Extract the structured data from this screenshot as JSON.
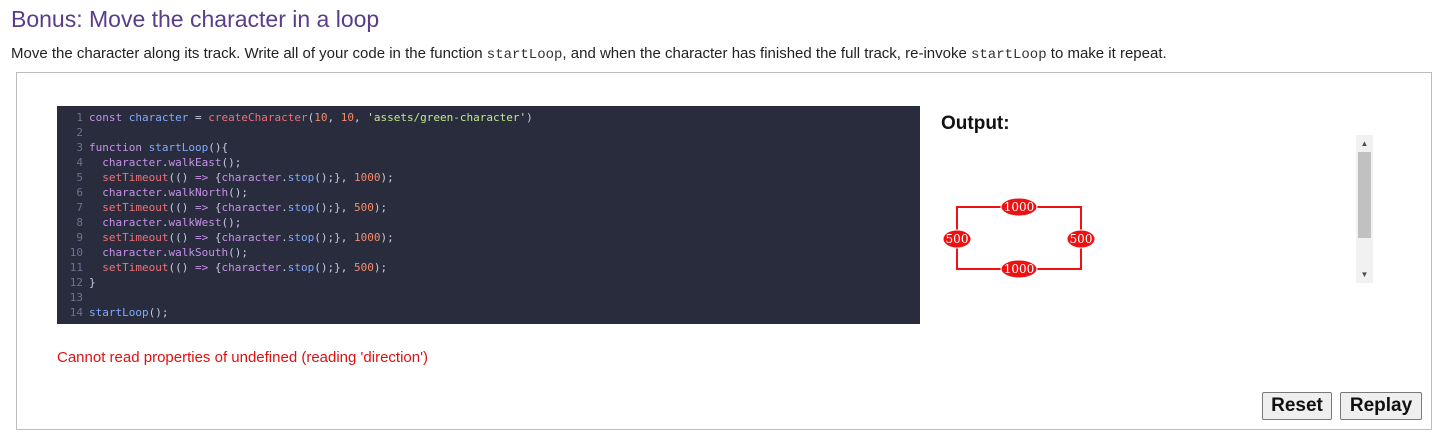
{
  "header": {
    "title": "Bonus: Move the character in a loop",
    "description": {
      "part1": "Move the character along its track. Write all of your code in the function ",
      "code1": "startLoop",
      "part2": ", and when the character has finished the full track, re-invoke ",
      "code2": "startLoop",
      "part3": " to make it repeat."
    }
  },
  "editor": {
    "lines": [
      {
        "n": "1",
        "tokens": [
          [
            "kw",
            "const "
          ],
          [
            "var",
            "character"
          ],
          [
            "punc",
            " = "
          ],
          [
            "fn",
            "createCharacter"
          ],
          [
            "punc",
            "("
          ],
          [
            "num",
            "10"
          ],
          [
            "punc",
            ", "
          ],
          [
            "num",
            "10"
          ],
          [
            "punc",
            ", "
          ],
          [
            "str",
            "'assets/green-character'"
          ],
          [
            "punc",
            ")"
          ]
        ]
      },
      {
        "n": "2",
        "tokens": []
      },
      {
        "n": "3",
        "tokens": [
          [
            "kw",
            "function "
          ],
          [
            "var",
            "startLoop"
          ],
          [
            "punc",
            "(){"
          ]
        ]
      },
      {
        "n": "4",
        "tokens": [
          [
            "punc",
            "  "
          ],
          [
            "meth",
            "character"
          ],
          [
            "punc",
            "."
          ],
          [
            "meth",
            "walkEast"
          ],
          [
            "punc",
            "();"
          ]
        ]
      },
      {
        "n": "5",
        "tokens": [
          [
            "punc",
            "  "
          ],
          [
            "fn",
            "setTimeout"
          ],
          [
            "punc",
            "(() "
          ],
          [
            "kw",
            "=>"
          ],
          [
            "punc",
            " {"
          ],
          [
            "meth",
            "character"
          ],
          [
            "punc",
            "."
          ],
          [
            "var",
            "stop"
          ],
          [
            "punc",
            "();}, "
          ],
          [
            "num",
            "1000"
          ],
          [
            "punc",
            ");"
          ]
        ]
      },
      {
        "n": "6",
        "tokens": [
          [
            "punc",
            "  "
          ],
          [
            "meth",
            "character"
          ],
          [
            "punc",
            "."
          ],
          [
            "meth",
            "walkNorth"
          ],
          [
            "punc",
            "();"
          ]
        ]
      },
      {
        "n": "7",
        "tokens": [
          [
            "punc",
            "  "
          ],
          [
            "fn",
            "setTimeout"
          ],
          [
            "punc",
            "(() "
          ],
          [
            "kw",
            "=>"
          ],
          [
            "punc",
            " {"
          ],
          [
            "meth",
            "character"
          ],
          [
            "punc",
            "."
          ],
          [
            "var",
            "stop"
          ],
          [
            "punc",
            "();}, "
          ],
          [
            "num",
            "500"
          ],
          [
            "punc",
            ");"
          ]
        ]
      },
      {
        "n": "8",
        "tokens": [
          [
            "punc",
            "  "
          ],
          [
            "meth",
            "character"
          ],
          [
            "punc",
            "."
          ],
          [
            "meth",
            "walkWest"
          ],
          [
            "punc",
            "();"
          ]
        ]
      },
      {
        "n": "9",
        "tokens": [
          [
            "punc",
            "  "
          ],
          [
            "fn",
            "setTimeout"
          ],
          [
            "punc",
            "(() "
          ],
          [
            "kw",
            "=>"
          ],
          [
            "punc",
            " {"
          ],
          [
            "meth",
            "character"
          ],
          [
            "punc",
            "."
          ],
          [
            "var",
            "stop"
          ],
          [
            "punc",
            "();}, "
          ],
          [
            "num",
            "1000"
          ],
          [
            "punc",
            ");"
          ]
        ]
      },
      {
        "n": "10",
        "tokens": [
          [
            "punc",
            "  "
          ],
          [
            "meth",
            "character"
          ],
          [
            "punc",
            "."
          ],
          [
            "meth",
            "walkSouth"
          ],
          [
            "punc",
            "();"
          ]
        ]
      },
      {
        "n": "11",
        "tokens": [
          [
            "punc",
            "  "
          ],
          [
            "fn",
            "setTimeout"
          ],
          [
            "punc",
            "(() "
          ],
          [
            "kw",
            "=>"
          ],
          [
            "punc",
            " {"
          ],
          [
            "meth",
            "character"
          ],
          [
            "punc",
            "."
          ],
          [
            "var",
            "stop"
          ],
          [
            "punc",
            "();}, "
          ],
          [
            "num",
            "500"
          ],
          [
            "punc",
            ");"
          ]
        ]
      },
      {
        "n": "12",
        "tokens": [
          [
            "punc",
            "}"
          ]
        ]
      },
      {
        "n": "13",
        "tokens": []
      },
      {
        "n": "14",
        "tokens": [
          [
            "var",
            "startLoop"
          ],
          [
            "punc",
            "();"
          ]
        ]
      }
    ]
  },
  "error_message": "Cannot read properties of undefined (reading 'direction')",
  "output": {
    "label": "Output:",
    "track_labels": {
      "top": "1000",
      "right": "500",
      "bottom": "1000",
      "left": "500"
    },
    "track_color": "#ee1111"
  },
  "buttons": {
    "reset": "Reset",
    "replay": "Replay"
  },
  "icons": {
    "scroll_up": "scroll-up-arrow-icon",
    "scroll_down": "scroll-down-arrow-icon"
  }
}
